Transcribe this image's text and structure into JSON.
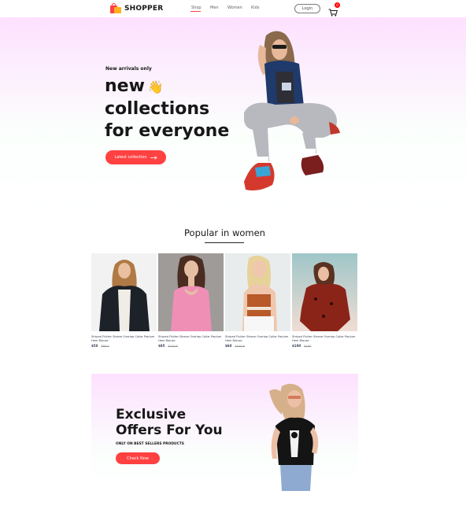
{
  "nav": {
    "brand": "SHOPPER",
    "menu": [
      "Shop",
      "Men",
      "Women",
      "Kids"
    ],
    "login_label": "Login",
    "cart_count": "0",
    "accent": "#ff4141"
  },
  "hero": {
    "tag": "New arrivals only",
    "title_line1": "new",
    "title_line2": "collections",
    "title_line3": "for everyone",
    "wave_emoji": "👋",
    "button_label": "Latest collection",
    "button_icon": "arrow-right-icon"
  },
  "popular": {
    "title": "Popular in women",
    "products": [
      {
        "name": "Striped Flutter Sleeve Overlap Collar Peplum Hem Blouse",
        "new_price": "$50",
        "old_price": "$80.5"
      },
      {
        "name": "Striped Flutter Sleeve Overlap Collar Peplum Hem Blouse",
        "new_price": "$85",
        "old_price": "$120.5"
      },
      {
        "name": "Striped Flutter Sleeve Overlap Collar Peplum Hem Blouse",
        "new_price": "$60",
        "old_price": "$100.5"
      },
      {
        "name": "Striped Flutter Sleeve Overlap Collar Peplum Hem Blouse",
        "new_price": "$100",
        "old_price": "$150"
      }
    ]
  },
  "offers": {
    "title_line1": "Exclusive",
    "title_line2": "Offers For You",
    "subtitle": "ONLY ON BEST SELLERS PRODUCTS",
    "button_label": "Check Now"
  }
}
